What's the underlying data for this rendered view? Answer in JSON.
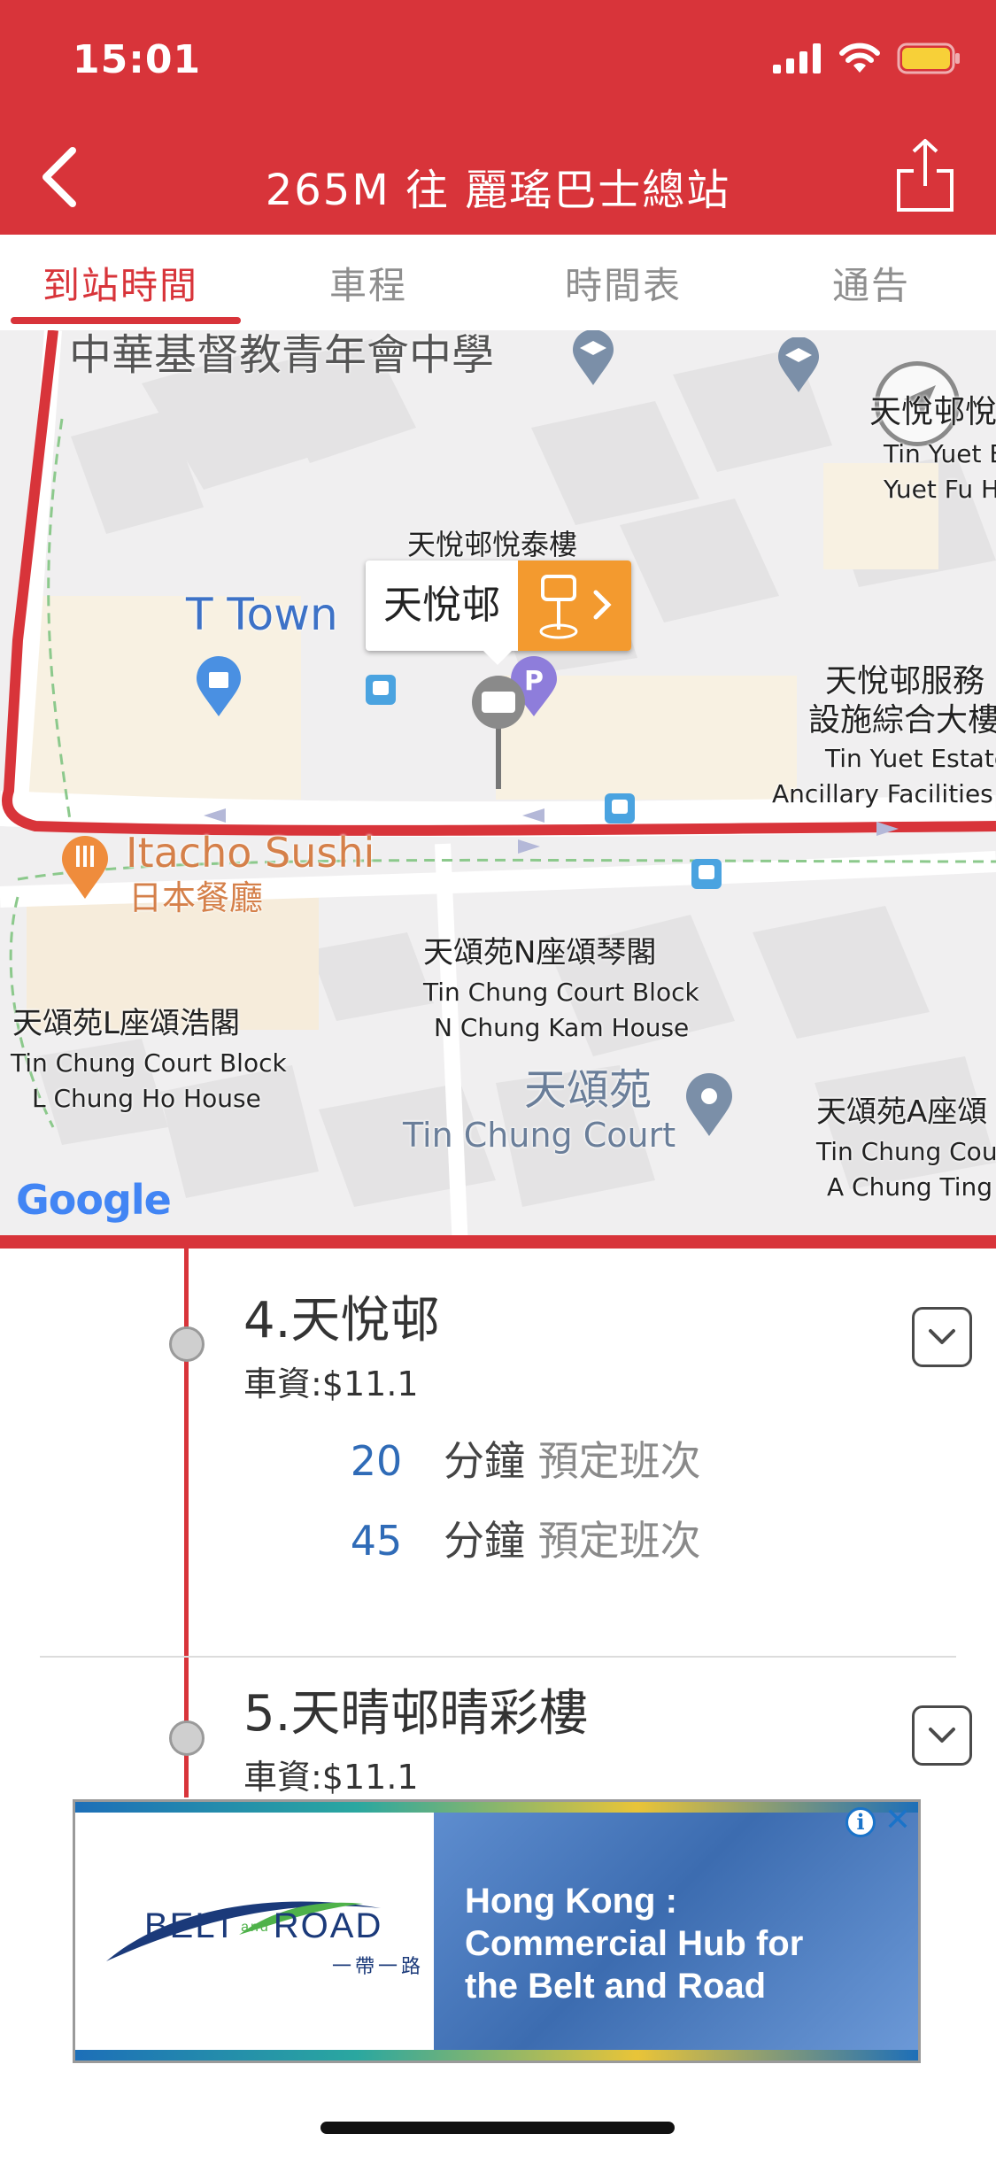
{
  "status_bar": {
    "time": "15:01"
  },
  "nav": {
    "title": "265M 往 麗瑤巴士總站"
  },
  "tabs": [
    {
      "label": "到站時間",
      "active": true
    },
    {
      "label": "車程",
      "active": false
    },
    {
      "label": "時間表",
      "active": false
    },
    {
      "label": "通告",
      "active": false
    }
  ],
  "map": {
    "labels": {
      "school": "中華基督教青年會中學",
      "yue_tai": "天悅邨悅泰樓",
      "t_town": "T Town",
      "tin_yuet_top_1": "天悅邨悅",
      "tin_yuet_top_2": "Tin Yuet E",
      "tin_yuet_top_3": "Yuet Fu H",
      "services_zh_1": "天悅邨服務",
      "services_zh_2": "設施綜合大樓",
      "services_en_1": "Tin Yuet Estate",
      "services_en_2": "Ancillary Facilities B",
      "itacho_en": "Itacho Sushi",
      "itacho_zh": "日本餐廳",
      "block_n_zh": "天頌苑N座頌琴閣",
      "block_n_en_1": "Tin Chung Court Block",
      "block_n_en_2": "N Chung Kam House",
      "block_l_zh": "天頌苑L座頌浩閣",
      "block_l_en_1": "Tin Chung Court Block",
      "block_l_en_2": "L Chung Ho House",
      "court_zh": "天頌苑",
      "court_en": "Tin Chung Court",
      "block_a_zh": "天頌苑A座頌",
      "block_a_en_1": "Tin Chung Cour",
      "block_a_en_2": "A Chung Ting H"
    },
    "callout": {
      "stop_name": "天悅邨"
    },
    "attribution": "Google",
    "route_color": "#d8343a"
  },
  "stops": [
    {
      "name": "4.天悅邨",
      "fare": "車資:$11.1",
      "etas": [
        {
          "minutes": "20",
          "unit": "分鐘",
          "note": "預定班次"
        },
        {
          "minutes": "45",
          "unit": "分鐘",
          "note": "預定班次"
        }
      ]
    },
    {
      "name": "5.天晴邨晴彩樓",
      "fare": "車資:$11.1"
    }
  ],
  "ad": {
    "logo_left": "BELT",
    "logo_and": "and",
    "logo_right": "ROAD",
    "logo_sub": "一帶一路",
    "headline_1": "Hong Kong :",
    "headline_2": "Commercial Hub for",
    "headline_3": "the Belt and Road",
    "info_glyph": "i",
    "close_glyph": "✕"
  },
  "colors": {
    "primary": "#d8343a",
    "eta_number": "#2f6bb7",
    "callout": "#f39a2f"
  }
}
